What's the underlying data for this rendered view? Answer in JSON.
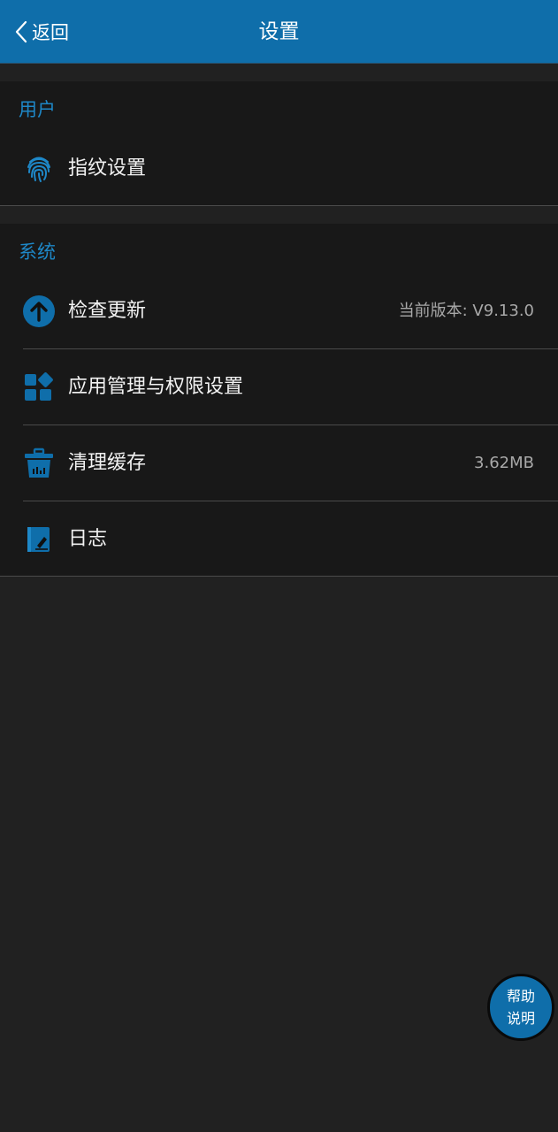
{
  "header": {
    "back_label": "返回",
    "title": "设置"
  },
  "sections": {
    "user": {
      "title": "用户",
      "items": [
        {
          "label": "指纹设置",
          "icon": "fingerprint-icon"
        }
      ]
    },
    "system": {
      "title": "系统",
      "items": [
        {
          "label": "检查更新",
          "value": "当前版本: V9.13.0",
          "icon": "upload-arrow-icon"
        },
        {
          "label": "应用管理与权限设置",
          "icon": "apps-grid-icon"
        },
        {
          "label": "清理缓存",
          "value": "3.62MB",
          "icon": "trash-basket-icon"
        },
        {
          "label": "日志",
          "icon": "log-book-icon"
        }
      ]
    }
  },
  "help_button": {
    "line1": "帮助",
    "line2": "说明"
  },
  "colors": {
    "accent": "#0f6eaa",
    "section_title": "#1e88c8",
    "background": "#212121",
    "card": "#181818"
  }
}
